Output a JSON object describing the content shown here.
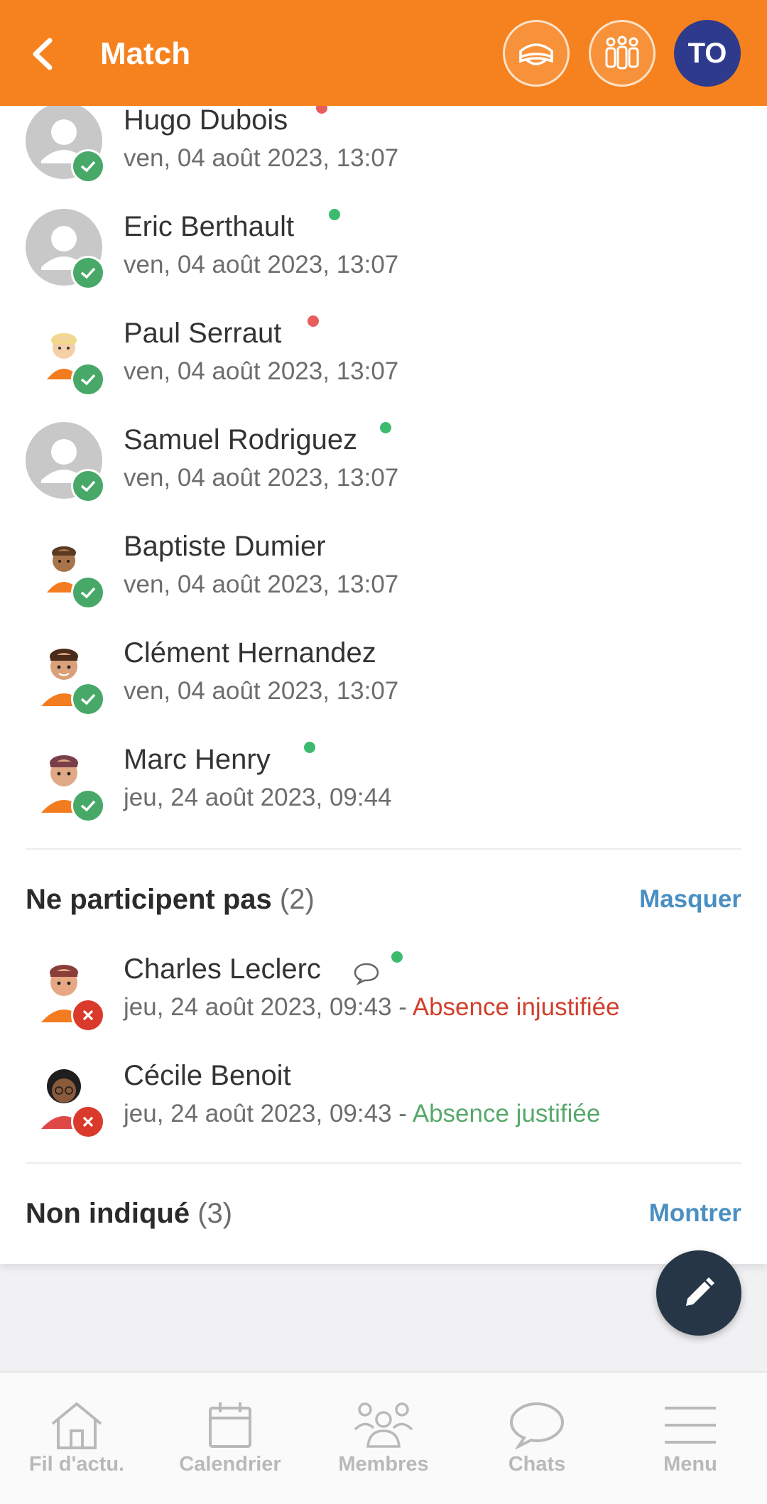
{
  "header": {
    "title": "Match",
    "avatar_initials": "TO"
  },
  "participants": [
    {
      "name": "Hugo Dubois",
      "date": "ven, 04 août 2023, 13:07",
      "online": "red"
    },
    {
      "name": "Eric Berthault",
      "date": "ven, 04 août 2023, 13:07",
      "online": "green"
    },
    {
      "name": "Paul Serraut",
      "date": "ven, 04 août 2023, 13:07",
      "online": "red"
    },
    {
      "name": "Samuel Rodriguez",
      "date": "ven, 04 août 2023, 13:07",
      "online": "green"
    },
    {
      "name": "Baptiste Dumier",
      "date": "ven, 04 août 2023, 13:07"
    },
    {
      "name": "Clément Hernandez",
      "date": "ven, 04 août 2023, 13:07"
    },
    {
      "name": "Marc Henry",
      "date": "jeu, 24 août 2023, 09:44",
      "online": "green"
    }
  ],
  "not_participating": {
    "title": "Ne participent pas",
    "count": "(2)",
    "toggle": "Masquer",
    "items": [
      {
        "name": "Charles Leclerc",
        "date": "jeu, 24 août 2023, 09:43 - ",
        "reason": "Absence injustifiée",
        "online": "green"
      },
      {
        "name": "Cécile Benoit",
        "date": "jeu, 24 août 2023, 09:43 - ",
        "reason": "Absence justifiée"
      }
    ]
  },
  "not_indicated": {
    "title": "Non indiqué",
    "count": "(3)",
    "toggle": "Montrer"
  },
  "colors": {
    "header_bg": "#f6821f",
    "check_badge": "#48a868",
    "cross_badge": "#d93a2c",
    "link": "#4a8fc2",
    "fab": "#263646"
  },
  "bottom_nav": [
    {
      "label": "Fil d'actu.",
      "icon": "home-icon"
    },
    {
      "label": "Calendrier",
      "icon": "calendar-icon"
    },
    {
      "label": "Membres",
      "icon": "members-icon"
    },
    {
      "label": "Chats",
      "icon": "chat-icon"
    },
    {
      "label": "Menu",
      "icon": "menu-icon"
    }
  ]
}
